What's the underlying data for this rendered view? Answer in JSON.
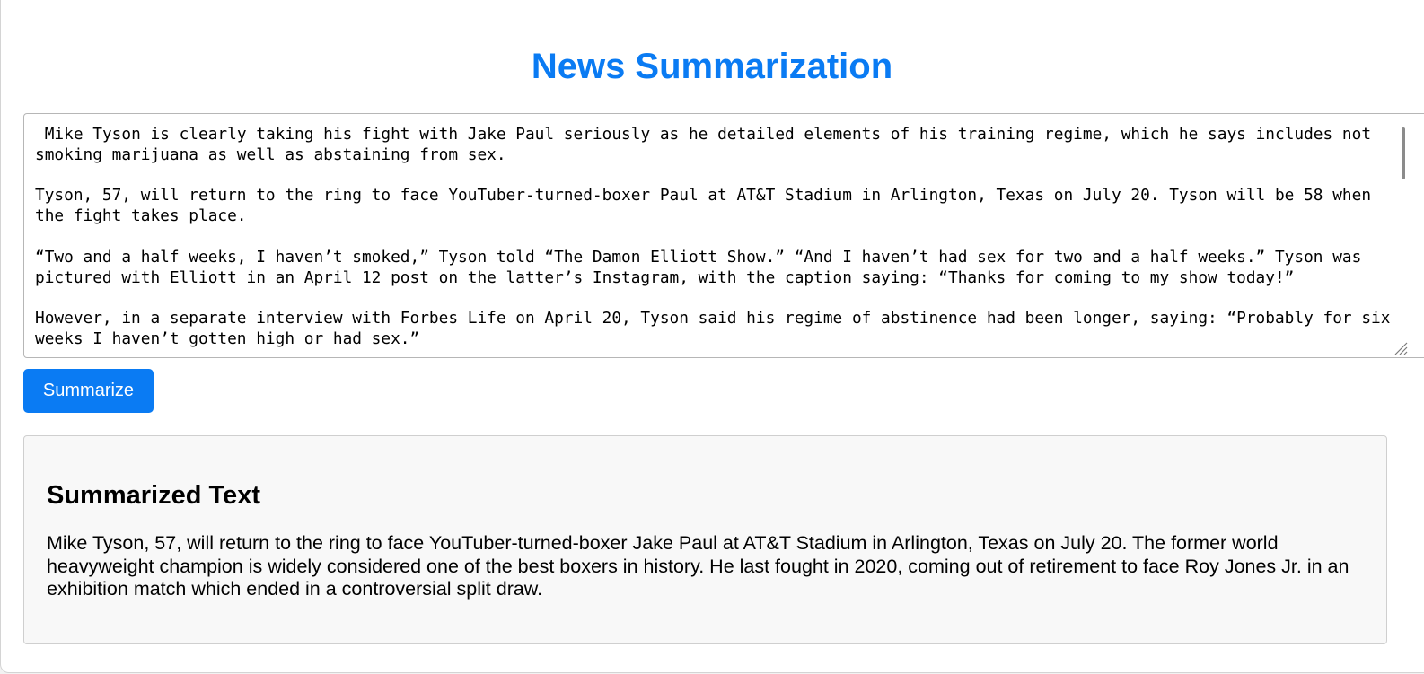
{
  "header": {
    "title": "News Summarization"
  },
  "input": {
    "article_text": " Mike Tyson is clearly taking his fight with Jake Paul seriously as he detailed elements of his training regime, which he says includes not smoking marijuana as well as abstaining from sex.\n\nTyson, 57, will return to the ring to face YouTuber-turned-boxer Paul at AT&T Stadium in Arlington, Texas on July 20. Tyson will be 58 when the fight takes place.\n\n“Two and a half weeks, I haven’t smoked,” Tyson told “The Damon Elliott Show.” “And I haven’t had sex for two and a half weeks.” Tyson was pictured with Elliott in an April 12 post on the latter’s Instagram, with the caption saying: “Thanks for coming to my show today!”\n\nHowever, in a separate interview with Forbes Life on April 20, Tyson said his regime of abstinence had been longer, saying: “Probably for six weeks I haven’t gotten high or had sex.”"
  },
  "actions": {
    "summarize_label": "Summarize"
  },
  "result": {
    "heading": "Summarized Text",
    "text": "Mike Tyson, 57, will return to the ring to face YouTuber-turned-boxer Jake Paul at AT&T Stadium in Arlington, Texas on July 20. The former world heavyweight champion is widely considered one of the best boxers in history. He last fought in 2020, coming out of retirement to face Roy Jones Jr. in an exhibition match which ended in a controversial split draw."
  },
  "colors": {
    "accent": "#0a7bf3",
    "panel_background": "#f8f8f8",
    "page_background": "#ffffff"
  }
}
